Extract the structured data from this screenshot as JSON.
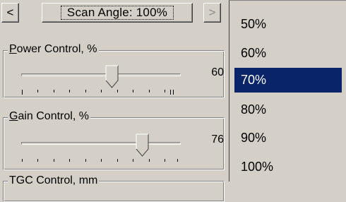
{
  "toolbar": {
    "prev_label": "<",
    "scan_angle_label": "Scan Angle: 100%",
    "next_label": ">"
  },
  "controls": [
    {
      "title_prefix": "",
      "title_accel": "P",
      "title_rest": "ower Control, %",
      "value": "60",
      "level_percent": 60
    },
    {
      "title_prefix": "",
      "title_accel": "G",
      "title_rest": "ain Control, %",
      "value": "76",
      "level_percent": 76
    },
    {
      "title_prefix": "",
      "title_accel": "",
      "title_rest": "TGC Control, mm",
      "value": "",
      "level_percent": null
    }
  ],
  "dropdown": {
    "options": [
      "50%",
      "60%",
      "70%",
      "80%",
      "90%",
      "100%"
    ],
    "selected_index": 2
  },
  "colors": {
    "face": "#d4d0c8",
    "selection": "#0a246a",
    "selection_text": "#ffffff"
  }
}
